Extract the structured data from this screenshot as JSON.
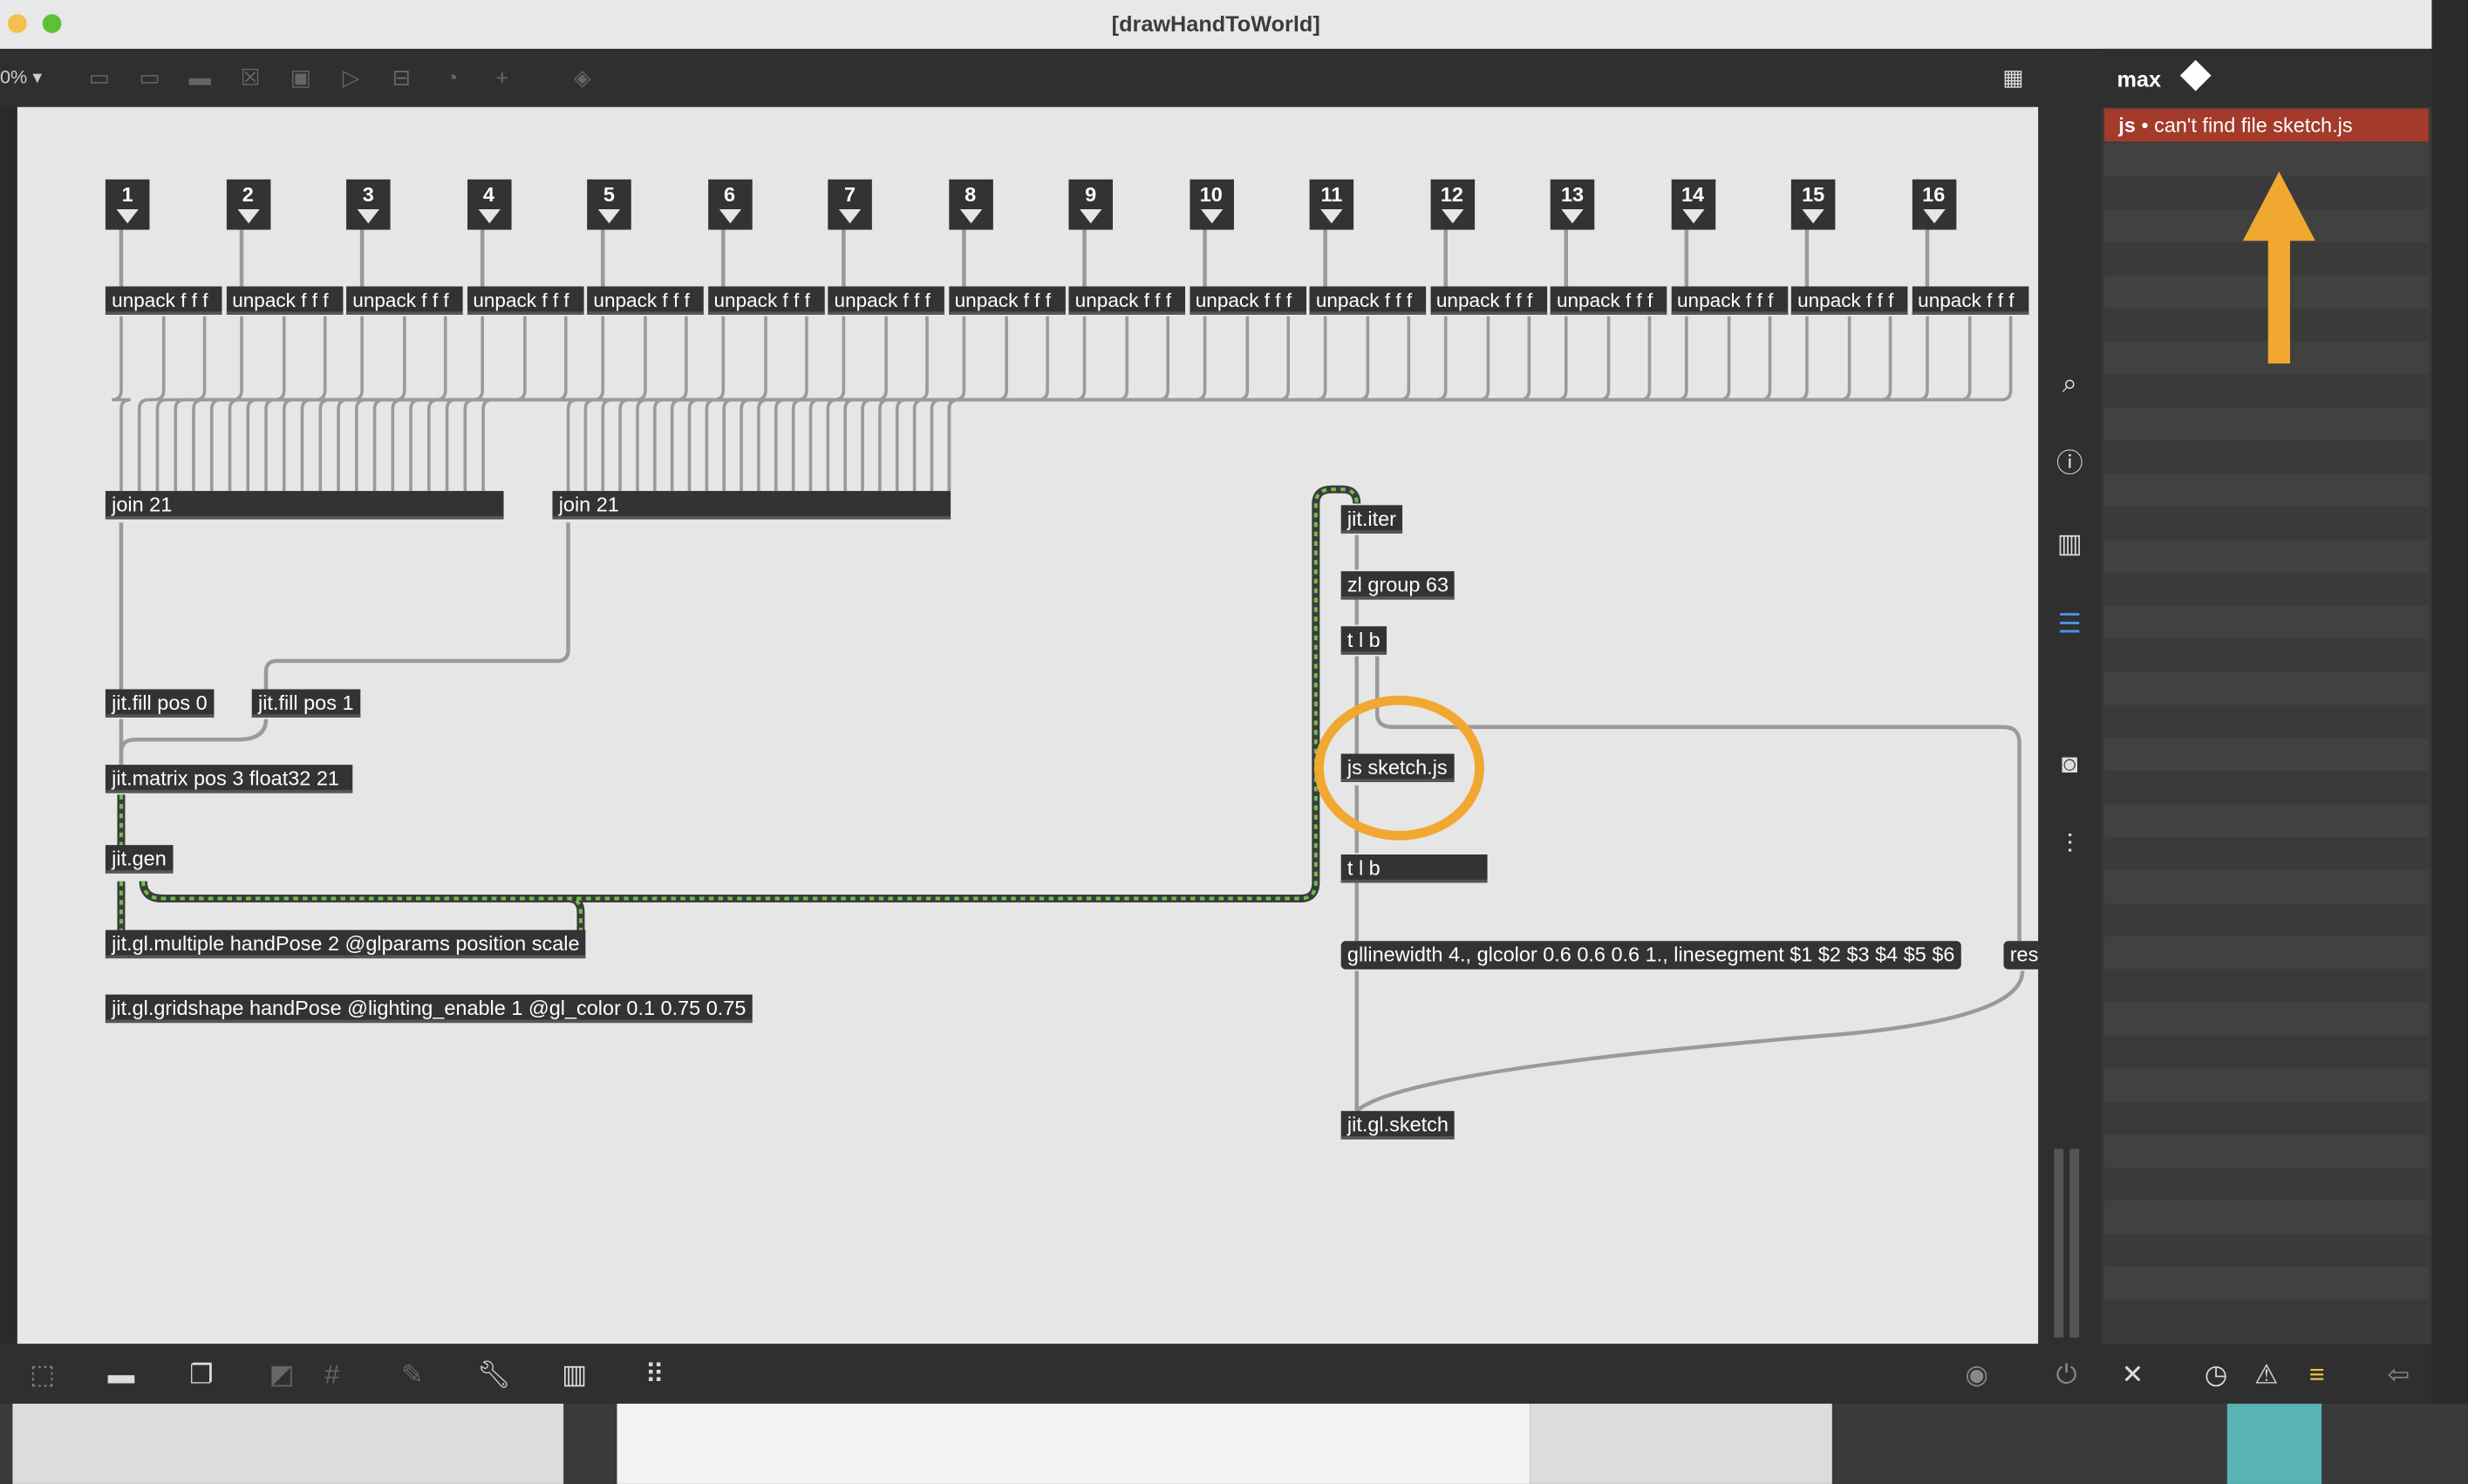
{
  "window": {
    "title": "[drawHandToWorld]",
    "zoom": "0% ▾"
  },
  "inlets": [
    "1",
    "2",
    "3",
    "4",
    "5",
    "6",
    "7",
    "8",
    "9",
    "10",
    "11",
    "12",
    "13",
    "14",
    "15",
    "16"
  ],
  "unpack_label": "unpack f f f",
  "objects": {
    "join_a": "join 21",
    "join_b": "join 21",
    "fill0": "jit.fill pos 0",
    "fill1": "jit.fill pos 1",
    "matrix": "jit.matrix pos 3 float32 21",
    "gen": "jit.gen",
    "multiple": "jit.gl.multiple handPose 2 @glparams position scale",
    "gridshape": "jit.gl.gridshape handPose @lighting_enable 1 @gl_color 0.1 0.75 0.75",
    "iter": "jit.iter",
    "zl": "zl group 63",
    "tlb1": "t l b",
    "js": "js sketch.js",
    "tlb2": "t l b",
    "msg": "gllinewidth 4., glcolor 0.6 0.6 0.6 1., linesegment $1 $2 $3 $4 $5 $6",
    "res": "res",
    "sketch": "jit.gl.sketch"
  },
  "console": {
    "title": "max",
    "error_source": "js",
    "error_message": " • can't find file sketch.js"
  },
  "colors": {
    "accent_annotation": "#f0a830",
    "error_row": "#a33a2a",
    "canvas": "#e6e6e6",
    "object_box": "#333333",
    "signal_wire": "#6cc04a"
  }
}
